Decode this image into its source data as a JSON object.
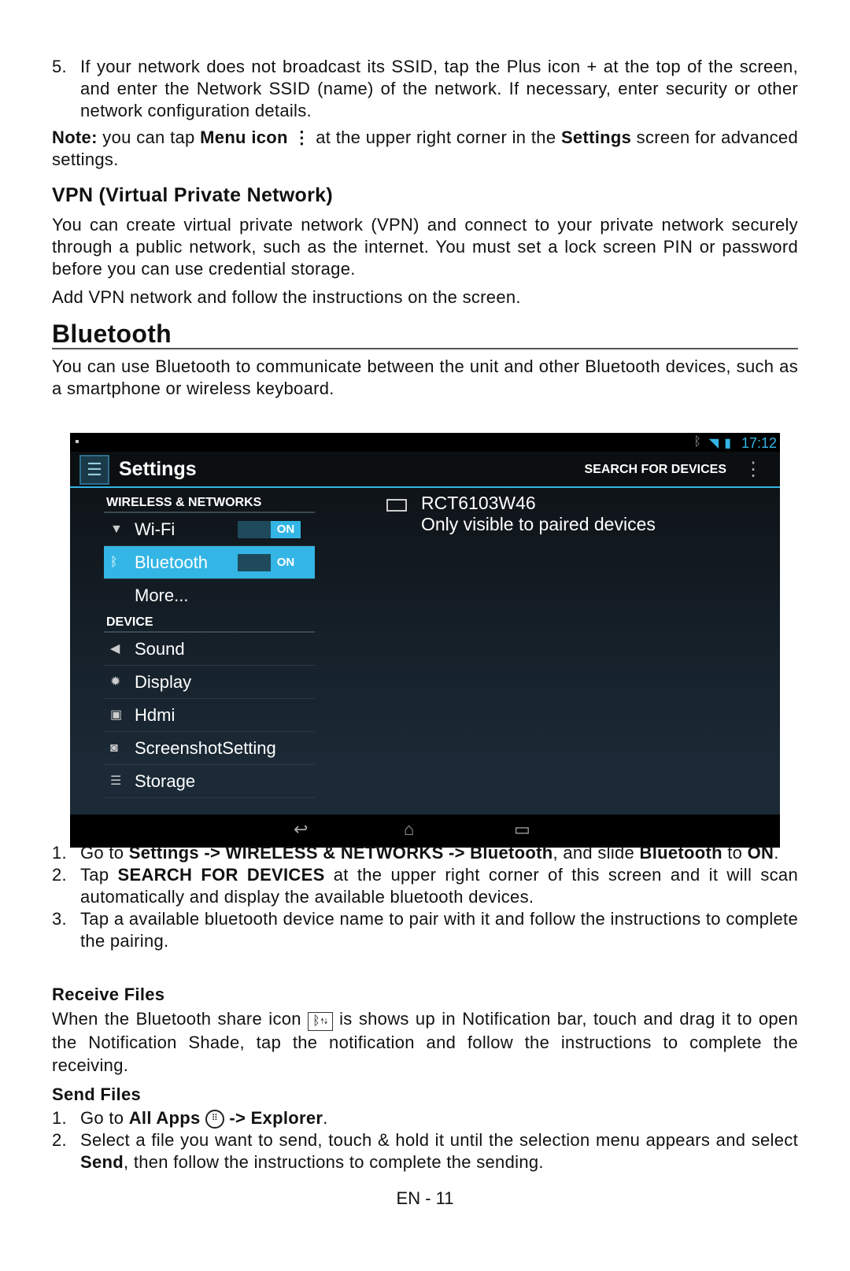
{
  "intro": {
    "step5": {
      "n": "5.",
      "text": "If your network does not broadcast its SSID, tap the Plus icon + at the top of the screen, and enter the Network SSID (name) of the network. If necessary, enter security or other network configuration details."
    },
    "note": {
      "label": "Note:",
      "t1": " you can tap ",
      "menu": "Menu icon",
      "t2": " at the upper right corner in the ",
      "settings": "Settings",
      "t3": " screen for advanced settings."
    }
  },
  "vpn": {
    "heading": "VPN (Virtual Private Network)",
    "p1": "You can create virtual private network (VPN) and connect to your private network securely through a public network, such as the internet. You must set a lock screen PIN or password before you can use credential storage.",
    "p2": "Add VPN network and follow the instructions on the screen."
  },
  "bluetooth": {
    "heading": "Bluetooth",
    "p1": "You can use Bluetooth to communicate between the unit and other Bluetooth devices, such as a smartphone or wireless keyboard."
  },
  "screen": {
    "time": "17:12",
    "title": "Settings",
    "search": "SEARCH FOR DEVICES",
    "section1": "WIRELESS & NETWORKS",
    "section2": "DEVICE",
    "wifi": "Wi-Fi",
    "bt": "Bluetooth",
    "more": "More...",
    "on": "ON",
    "device_items": [
      "Sound",
      "Display",
      "Hdmi",
      "ScreenshotSetting",
      "Storage"
    ],
    "device_name": "RCT6103W46",
    "device_status": "Only visible to paired devices",
    "accent": "#33b5e5"
  },
  "steps": [
    {
      "n": "1.",
      "a": "Go to ",
      "b": "Settings -> WIRELESS & NETWORKS -> Bluetooth",
      "c": ", and slide ",
      "d": "Bluetooth",
      "e": " to ",
      "f": "ON",
      "g": "."
    },
    {
      "n": "2.",
      "a": "Tap ",
      "b": "SEARCH FOR DEVICES",
      "c": " at the upper right corner of this screen and it will scan automatically and display the available bluetooth devices."
    },
    {
      "n": "3.",
      "a": "Tap a available bluetooth device name to pair with it and follow the instructions to complete the pairing."
    }
  ],
  "receive": {
    "heading": "Receive Files",
    "t1": "When the Bluetooth share icon ",
    "t2": " is shows up in Notification bar, touch and drag it to open the Notification Shade, tap the notification and follow the instructions to complete the receiving."
  },
  "send": {
    "heading": "Send Files",
    "s1": {
      "n": "1.",
      "a": "Go to ",
      "b": "All Apps",
      "c": " -> ",
      "d": "Explorer",
      "e": "."
    },
    "s2": {
      "n": "2.",
      "a": "Select a file you want to send, touch & hold it until the selection menu appears and select ",
      "b": "Send",
      "c": ", then follow the instructions to complete the sending."
    }
  },
  "footer": "EN - 11"
}
